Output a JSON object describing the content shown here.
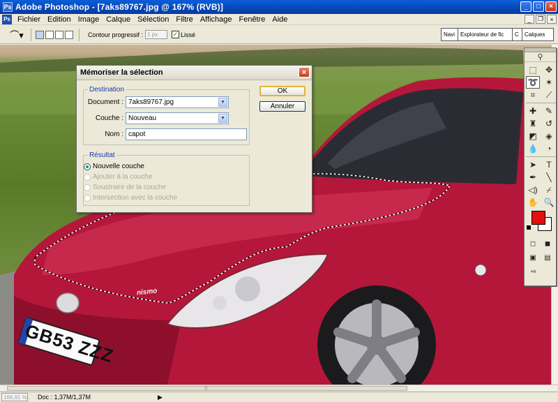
{
  "window": {
    "title": "Adobe Photoshop - [7aks89767.jpg @ 167% (RVB)]",
    "minimize": "_",
    "maximize": "□",
    "close": "×"
  },
  "menu": {
    "items": [
      "Fichier",
      "Edition",
      "Image",
      "Calque",
      "Sélection",
      "Filtre",
      "Affichage",
      "Fenêtre",
      "Aide"
    ]
  },
  "options": {
    "feather_label": "Contour progressif :",
    "feather_value": "1 px",
    "antialias_label": "Lissé",
    "palette_tabs": [
      "Navi",
      "Explorateur de fic",
      "C",
      "Calques"
    ]
  },
  "dialog": {
    "title": "Mémoriser la sélection",
    "close": "×",
    "destination_legend": "Destination",
    "document_label": "Document :",
    "document_value": "7aks89767.jpg",
    "layer_label": "Couche :",
    "layer_value": "Nouveau",
    "name_label": "Nom :",
    "name_value": "capot",
    "result_legend": "Résultat",
    "options": [
      "Nouvelle couche",
      "Ajouter à la couche",
      "Soustraire de la couche",
      "Intersection avec la couche"
    ],
    "ok": "OK",
    "cancel": "Annuler"
  },
  "image": {
    "plate": "GB53 ZZZ",
    "badge": "nismo"
  },
  "status": {
    "zoom": "166,91 %",
    "doc": "Doc : 1,37M/1,37M",
    "arrow": "▶"
  },
  "toolbox": {
    "foreground": "#e01010",
    "background": "#ffffff"
  }
}
